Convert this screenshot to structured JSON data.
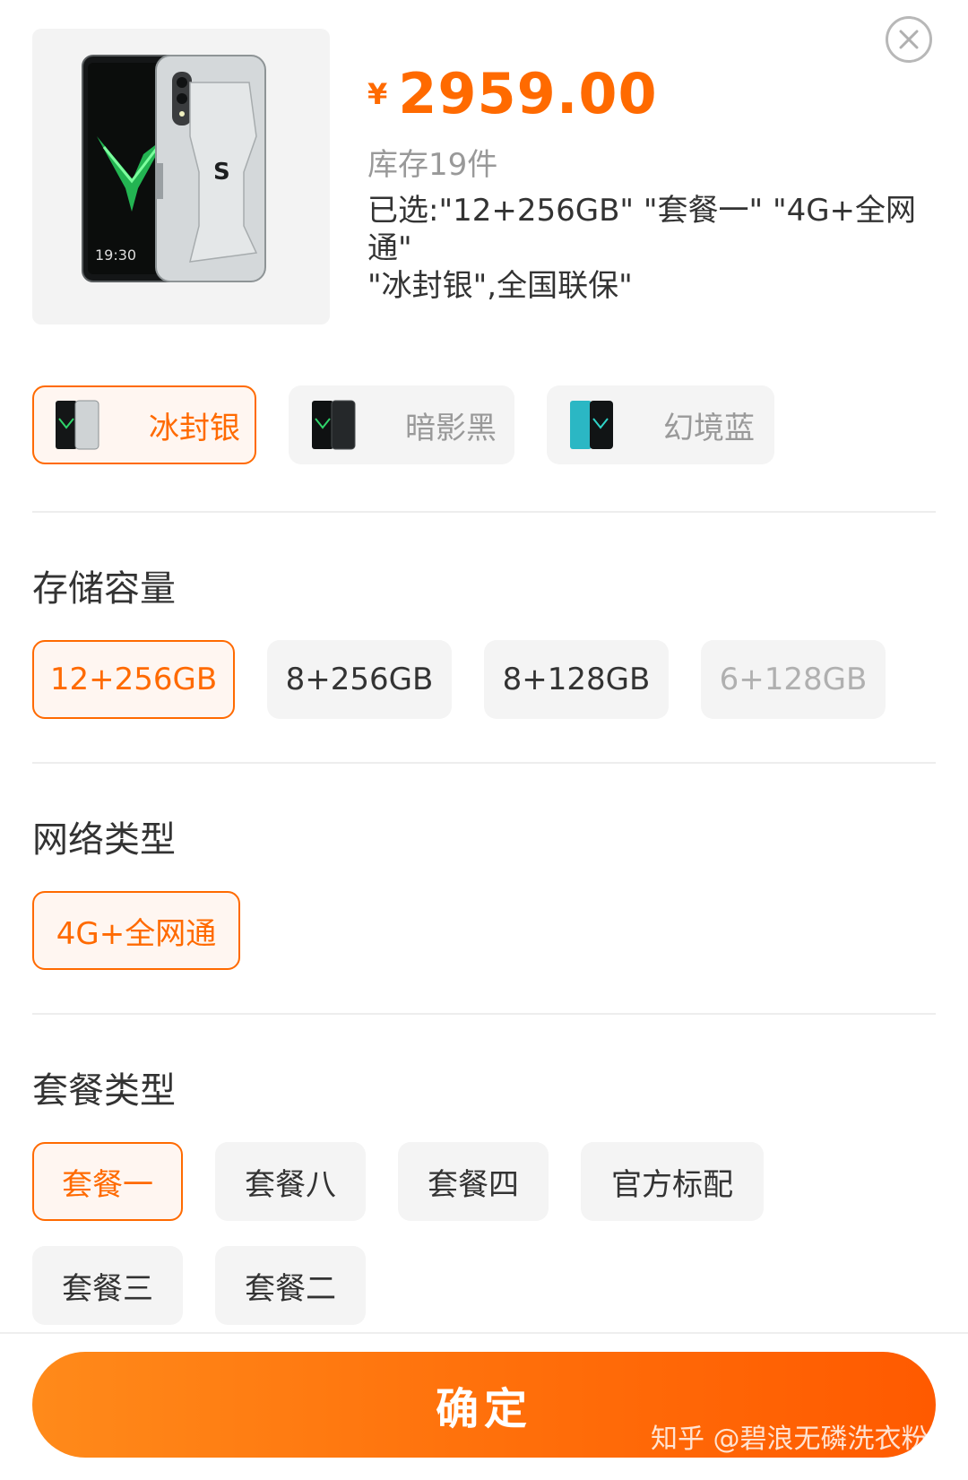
{
  "product": {
    "price_currency": "¥",
    "price": "2959.00",
    "stock": "库存19件",
    "selected_line1": "已选:\"12+256GB\" \"套餐一\" \"4G+全网通\"",
    "selected_line2": "\"冰封银\",全国联保\"",
    "image_screen_time": "19:30"
  },
  "colors": {
    "options": [
      {
        "label": "冰封银",
        "state": "selected",
        "swatch": "#c9cdd0"
      },
      {
        "label": "暗影黑",
        "state": "normal",
        "swatch": "#1c1f22"
      },
      {
        "label": "幻境蓝",
        "state": "normal",
        "swatch": "#2bb7c4"
      }
    ]
  },
  "storage": {
    "title": "存储容量",
    "options": [
      {
        "label": "12+256GB",
        "state": "selected"
      },
      {
        "label": "8+256GB",
        "state": "normal"
      },
      {
        "label": "8+128GB",
        "state": "normal"
      },
      {
        "label": "6+128GB",
        "state": "disabled"
      }
    ]
  },
  "network": {
    "title": "网络类型",
    "options": [
      {
        "label": "4G+全网通",
        "state": "selected"
      }
    ]
  },
  "package": {
    "title": "套餐类型",
    "options": [
      {
        "label": "套餐一",
        "state": "selected"
      },
      {
        "label": "套餐八",
        "state": "normal"
      },
      {
        "label": "套餐四",
        "state": "normal"
      },
      {
        "label": "官方标配",
        "state": "normal"
      },
      {
        "label": "套餐三",
        "state": "normal"
      },
      {
        "label": "套餐二",
        "state": "normal"
      }
    ]
  },
  "confirm_label": "确定",
  "watermark": "知乎 @碧浪无磷洗衣粉",
  "theme": {
    "accent": "#ff6a00",
    "chip_bg": "#f4f4f4",
    "selected_bg": "#fff6f1"
  }
}
